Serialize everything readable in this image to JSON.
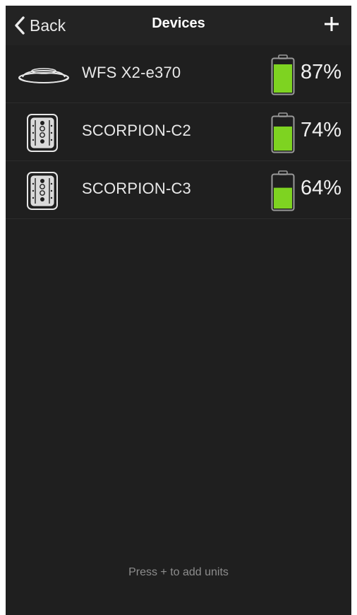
{
  "navbar": {
    "back_label": "Back",
    "title": "Devices",
    "add_icon": "plus-icon",
    "back_icon": "chevron-left-icon"
  },
  "devices": [
    {
      "name": "WFS X2-e370",
      "battery_percent_label": "87%",
      "battery_level": 0.87,
      "icon": "sensor-disc-icon"
    },
    {
      "name": "SCORPION-C2",
      "battery_percent_label": "74%",
      "battery_level": 0.74,
      "icon": "scorpion-device-icon"
    },
    {
      "name": "SCORPION-C3",
      "battery_percent_label": "64%",
      "battery_level": 0.64,
      "icon": "scorpion-device-icon"
    }
  ],
  "footer": {
    "hint": "Press + to add units"
  },
  "colors": {
    "battery_fill": "#7ed321",
    "background": "#1f1f1f",
    "text": "#e9e9e9"
  }
}
